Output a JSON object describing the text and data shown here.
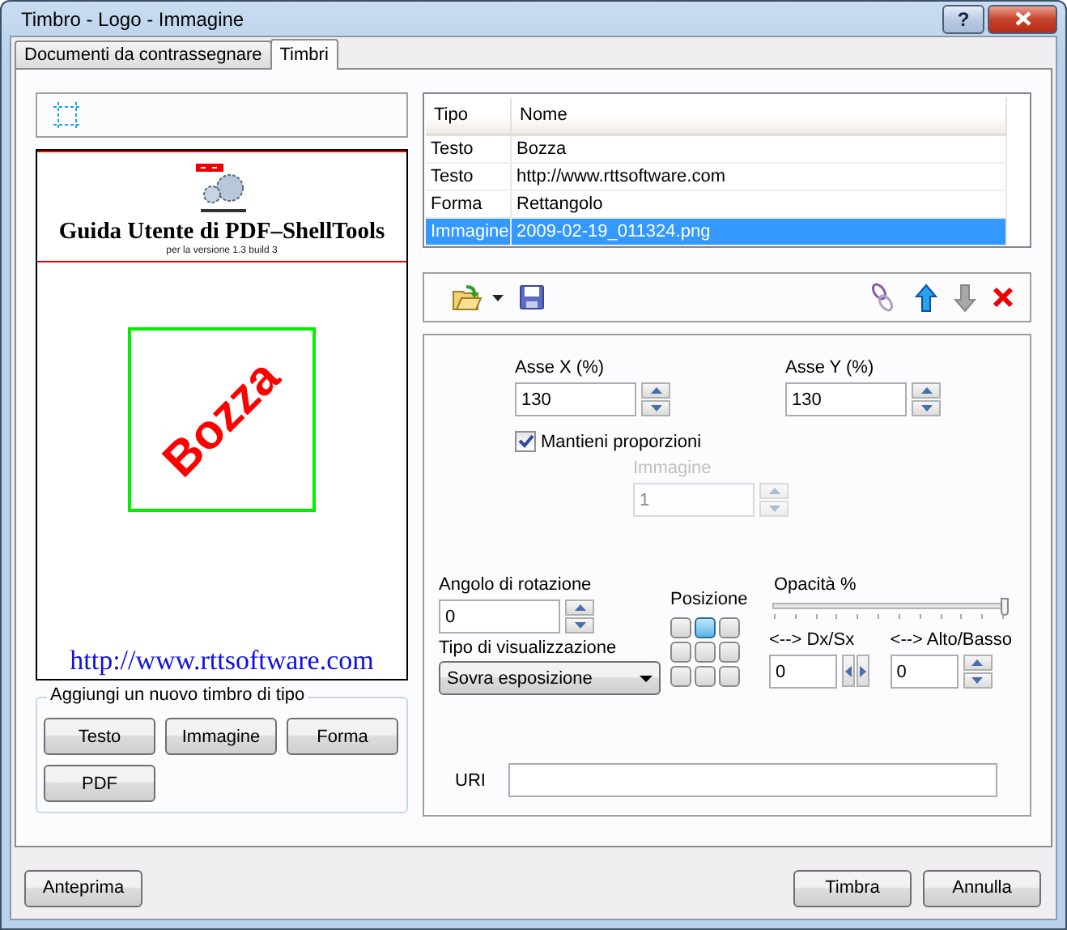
{
  "window": {
    "title": "Timbro - Logo - Immagine",
    "help": "?"
  },
  "tabs": [
    {
      "label": "Documenti da contrassegnare",
      "selected": false
    },
    {
      "label": "Timbri",
      "selected": true
    }
  ],
  "preview": {
    "heading": "Guida Utente di PDF–ShellTools",
    "subheading": "per la versione 1.3 build 3",
    "stamp": "Bozza",
    "url": "http://www.rttsoftware.com"
  },
  "add_group": {
    "title": "Aggiungi un nuovo timbro di tipo",
    "buttons": [
      "Testo",
      "Immagine",
      "Forma",
      "PDF"
    ]
  },
  "table": {
    "columns": [
      "Tipo",
      "Nome"
    ],
    "rows": [
      {
        "tipo": "Testo",
        "nome": "Bozza",
        "selected": false
      },
      {
        "tipo": "Testo",
        "nome": "http://www.rttsoftware.com",
        "selected": false
      },
      {
        "tipo": "Forma",
        "nome": "Rettangolo",
        "selected": false
      },
      {
        "tipo": "Immagine",
        "nome": "2009-02-19_011324.png",
        "selected": true
      }
    ]
  },
  "properties": {
    "scale_x": {
      "label": "Asse X (%)",
      "value": "130"
    },
    "scale_y": {
      "label": "Asse Y (%)",
      "value": "130"
    },
    "keep_ratio": {
      "label": "Mantieni proporzioni",
      "checked": true
    },
    "image": {
      "label": "Immagine",
      "value": "1",
      "disabled": true
    },
    "rotation": {
      "label": "Angolo di rotazione",
      "value": "0"
    },
    "display": {
      "label": "Tipo di visualizzazione",
      "value": "Sovra esposizione"
    },
    "position": {
      "label": "Posizione",
      "cells": [
        {
          "selected": false
        },
        {
          "selected": true
        },
        {
          "selected": false
        },
        {
          "selected": false
        },
        {
          "selected": false
        },
        {
          "selected": false
        },
        {
          "selected": false
        },
        {
          "selected": false
        },
        {
          "selected": false
        }
      ]
    },
    "opacity": {
      "label": "Opacità %",
      "level": 1
    },
    "offset_x": {
      "label": "<--> Dx/Sx",
      "value": "0"
    },
    "offset_y": {
      "label": "<--> Alto/Basso",
      "value": "0"
    },
    "uri": {
      "label": "URI"
    }
  },
  "footer": {
    "preview_button": "Anteprima",
    "buttons": [
      "Timbra",
      "Annulla"
    ]
  }
}
